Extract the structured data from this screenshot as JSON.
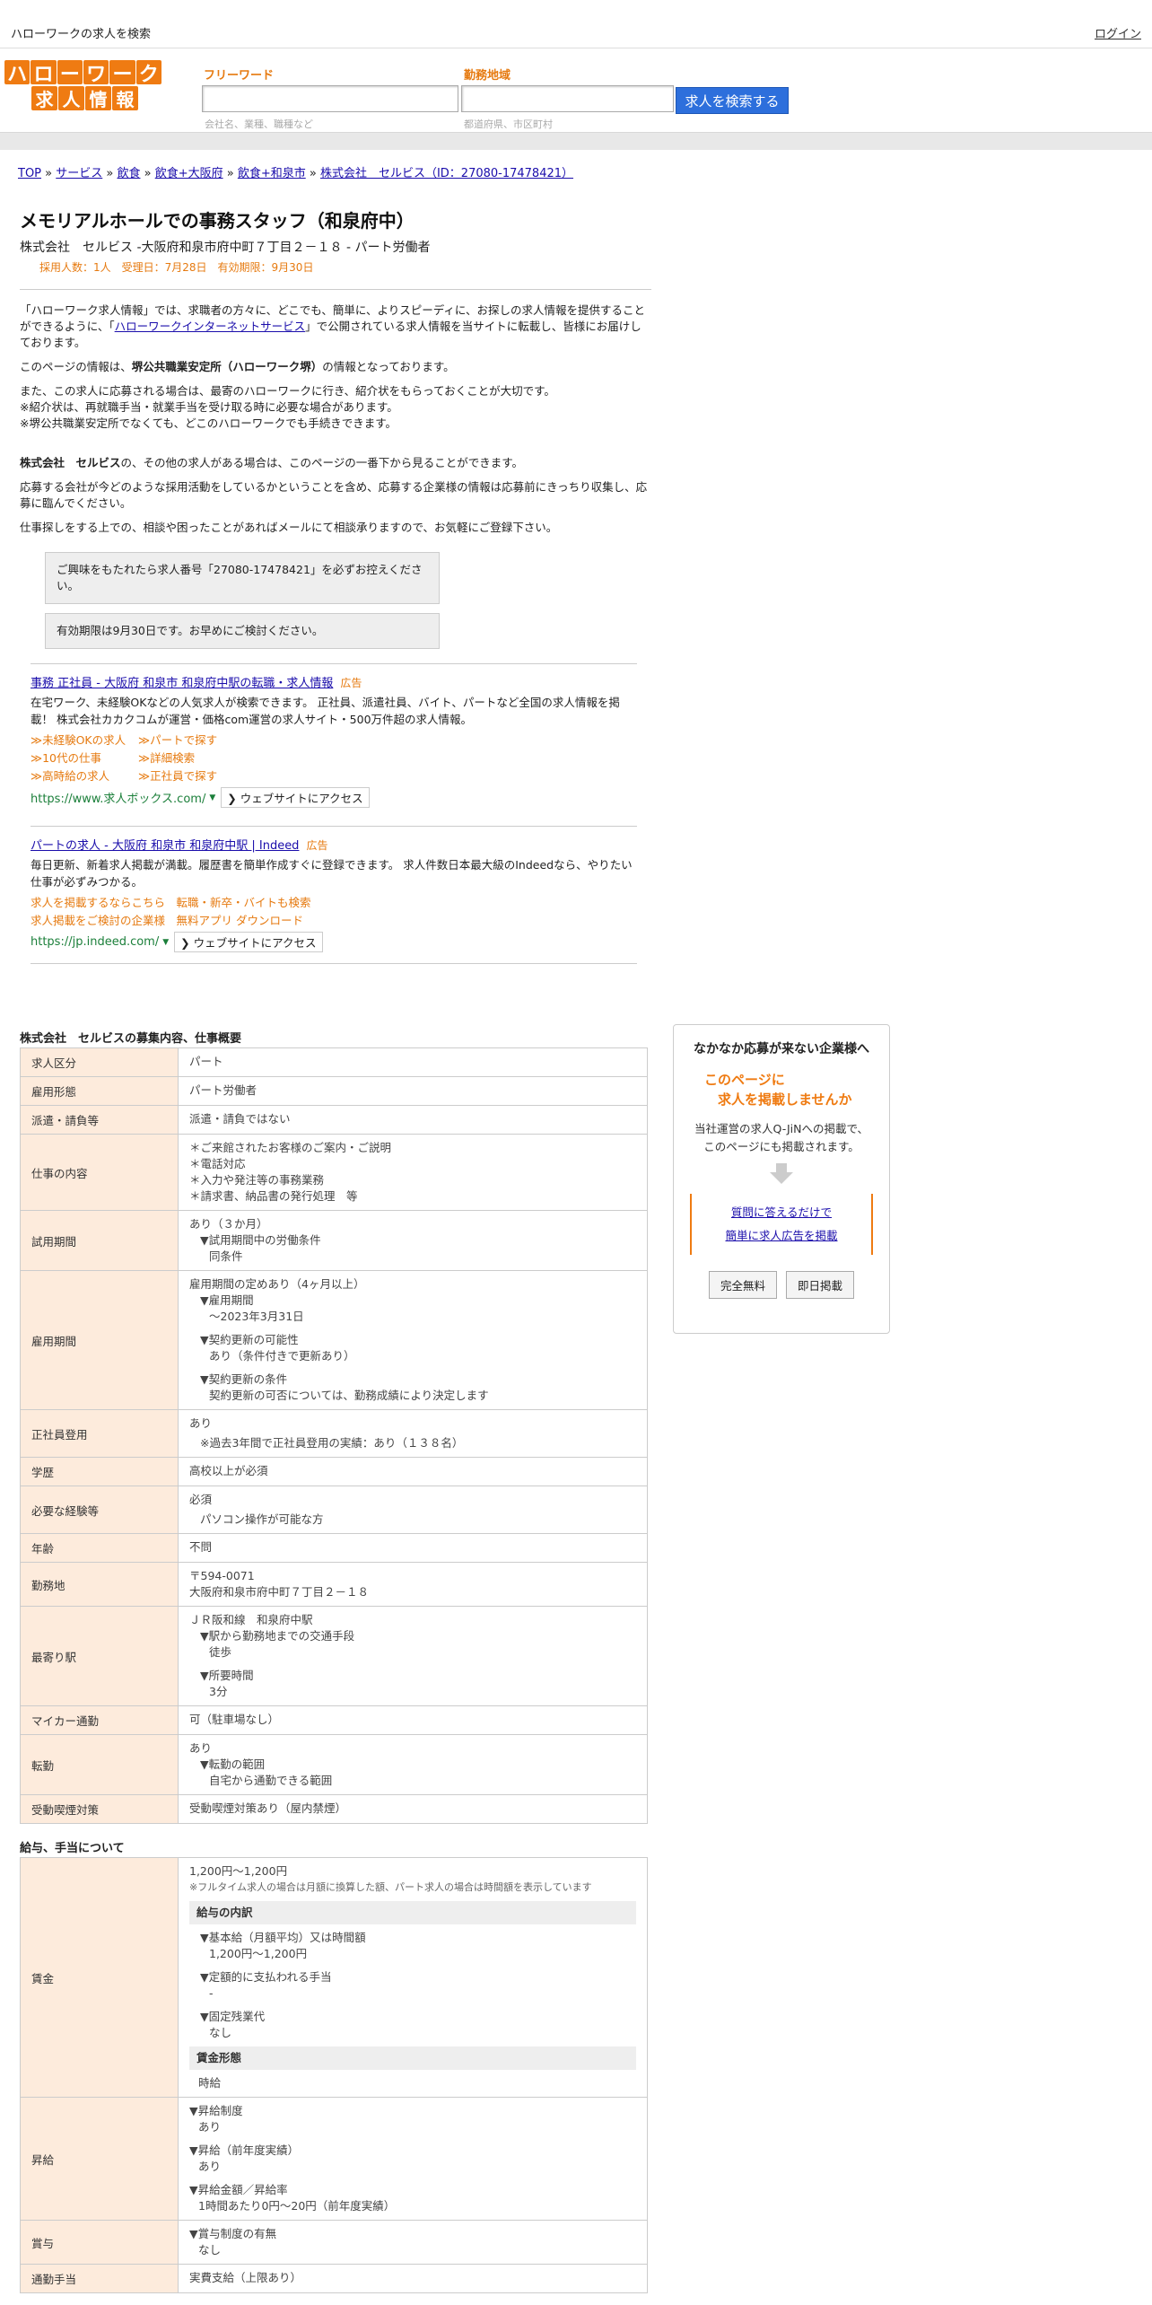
{
  "topbar": {
    "site_title": "ハローワークの求人を検索",
    "login": "ログイン"
  },
  "logo": {
    "row1": [
      "ハ",
      "ロ",
      "ー",
      "ワ",
      "ー",
      "ク"
    ],
    "row2": [
      "求",
      "人",
      "情",
      "報"
    ]
  },
  "search": {
    "freeword_label": "フリーワード",
    "freeword_hint": "会社名、業種、職種など",
    "area_label": "勤務地域",
    "area_hint": "都道府県、市区町村",
    "button": "求人を検索する"
  },
  "breadcrumb": {
    "items": [
      "TOP",
      "サービス",
      "飲食",
      "飲食+大阪府",
      "飲食+和泉市",
      "株式会社　セルビス（ID：27080-17478421）"
    ],
    "sep": " » "
  },
  "job": {
    "title": "メモリアルホールでの事務スタッフ（和泉府中）",
    "company_line": "株式会社　セルビス -大阪府和泉市府中町７丁目２－１８ - パート労働者",
    "meta": "採用人数：1人　受理日：7月28日　有効期限：9月30日"
  },
  "intro": {
    "p1_a": "「ハローワーク求人情報」では、求職者の方々に、どこでも、簡単に、よりスピーディに、お探しの求人情報を提供することができるように、「",
    "p1_link": "ハローワークインターネットサービス",
    "p1_b": "」で公開されている求人情報を当サイトに転載し、皆様にお届けしております。",
    "p2_a": "このページの情報は、",
    "p2_b": "堺公共職業安定所（ハローワーク堺）",
    "p2_c": "の情報となっております。",
    "p3": "また、この求人に応募される場合は、最寄のハローワークに行き、紹介状をもらっておくことが大切です。",
    "p3b": "※紹介状は、再就職手当・就業手当を受け取る時に必要な場合があります。",
    "p3c": "※堺公共職業安定所でなくても、どこのハローワークでも手続きできます。",
    "p4_a": "株式会社　セルビス",
    "p4_b": "の、その他の求人がある場合は、このページの一番下から見ることができます。",
    "p5": "応募する会社が今どのような採用活動をしているかということを含め、応募する企業様の情報は応募前にきっちり収集し、応募に臨んでください。",
    "p6": "仕事探しをする上での、相談や困ったことがあればメールにて相談承りますので、お気軽にご登録下さい。",
    "notice1": "ご興味をもたれたら求人番号「27080-17478421」を必ずお控えください。",
    "notice2": "有効期限は9月30日です。お早めにご検討ください。"
  },
  "ads": [
    {
      "title": "事務 正社員 - 大阪府 和泉市 和泉府中駅の転職・求人情報",
      "tag": "広告",
      "desc": "在宅ワーク、未経験OKなどの人気求人が検索できます。 正社員、派遣社員、バイト、パートなど全国の求人情報を掲載！ 株式会社カカクコムが運営・価格com運営の求人サイト・500万件超の求人情報。",
      "links": [
        "≫未経験OKの求人",
        "≫パートで探す",
        "≫10代の仕事",
        "≫詳細検索",
        "≫高時給の求人",
        "≫正社員で探す"
      ],
      "url": "https://www.求人ボックス.com/",
      "visit": "ウェブサイトにアクセス"
    },
    {
      "title": "パートの求人 - 大阪府 和泉市 和泉府中駅 | Indeed",
      "tag": "広告",
      "desc": "毎日更新、新着求人掲載が満載。履歴書を簡単作成すぐに登録できます。 求人件数日本最大級のIndeedなら、やりたい仕事が必ずみつかる。",
      "links": [
        "求人を掲載するならこちら　転職・新卒・バイトも検索",
        "求人掲載をご検討の企業様　無料アプリ ダウンロード"
      ],
      "url": "https://jp.indeed.com/",
      "visit": "ウェブサイトにアクセス"
    }
  ],
  "overview": {
    "title": "株式会社　セルビスの募集内容、仕事概要",
    "rows": {
      "kubun": {
        "h": "求人区分",
        "v": "パート"
      },
      "keitai": {
        "h": "雇用形態",
        "v": "パート労働者"
      },
      "haken": {
        "h": "派遣・請負等",
        "v": "派遣・請負ではない"
      },
      "shigoto": {
        "h": "仕事の内容",
        "lines": [
          "＊ご来館されたお客様のご案内・ご説明",
          "＊電話対応",
          "＊入力や発注等の事務業務",
          "＊請求書、納品書の発行処理　等"
        ]
      },
      "shiyo": {
        "h": "試用期間",
        "l1": "あり（３か月）",
        "l2": "▼試用期間中の労働条件",
        "l3": "同条件"
      },
      "koyou": {
        "h": "雇用期間",
        "l1": "雇用期間の定めあり（4ヶ月以上）",
        "l2": "▼雇用期間",
        "l3": "〜2023年3月31日",
        "l4": "▼契約更新の可能性",
        "l5": "あり（条件付きで更新あり）",
        "l6": "▼契約更新の条件",
        "l7": "契約更新の可否については、勤務成績により決定します"
      },
      "seisha": {
        "h": "正社員登用",
        "l1": "あり",
        "l2": "※過去3年間で正社員登用の実績：あり（１３８名）"
      },
      "gakureki": {
        "h": "学歴",
        "v": "高校以上が必須"
      },
      "keiken": {
        "h": "必要な経験等",
        "l1": "必須",
        "l2": "パソコン操作が可能な方"
      },
      "nenrei": {
        "h": "年齢",
        "v": "不問"
      },
      "kinmuchi": {
        "h": "勤務地",
        "l1": "〒594-0071",
        "l2": "大阪府和泉市府中町７丁目２－１８"
      },
      "eki": {
        "h": "最寄り駅",
        "l1": "ＪＲ阪和線　和泉府中駅",
        "l2": "▼駅から勤務地までの交通手段",
        "l3": "徒歩",
        "l4": "▼所要時間",
        "l5": "3分"
      },
      "mycar": {
        "h": "マイカー通勤",
        "v": "可（駐車場なし）"
      },
      "tenkin": {
        "h": "転勤",
        "l1": "あり",
        "l2": "▼転勤の範囲",
        "l3": "自宅から通勤できる範囲"
      },
      "judou": {
        "h": "受動喫煙対策",
        "v": "受動喫煙対策あり（屋内禁煙）"
      }
    }
  },
  "salary": {
    "title": "給与、手当について",
    "chingin": {
      "h": "賃金",
      "range": "1,200円〜1,200円",
      "note": "※フルタイム求人の場合は月額に換算した額、パート求人の場合は時間額を表示しています",
      "sub1": "給与の内訳",
      "k1": "▼基本給（月額平均）又は時間額",
      "k1v": "1,200円〜1,200円",
      "k2": "▼定額的に支払われる手当",
      "k2v": "-",
      "k3": "▼固定残業代",
      "k3v": "なし",
      "sub2": "賃金形態",
      "keitai": "時給"
    },
    "shokyu": {
      "h": "昇給",
      "l1": "▼昇給制度",
      "l2": "あり",
      "l3": "▼昇給（前年度実績）",
      "l4": "あり",
      "l5": "▼昇給金額／昇給率",
      "l6": "1時間あたり0円〜20円（前年度実績）"
    },
    "shoyo": {
      "h": "賞与",
      "l1": "▼賞与制度の有無",
      "l2": "なし"
    },
    "tsukin": {
      "h": "通勤手当",
      "l1": "実費支給（上限あり）"
    }
  },
  "side": {
    "title": "なかなか応募が来ない企業様へ",
    "orange1": "このページに",
    "orange2": "　求人を掲載しませんか",
    "desc1": "当社運営の求人Q-JiNへの掲載で、",
    "desc2": "このページにも掲載されます。",
    "link1": "質問に答えるだけで",
    "link2": "簡単に求人広告を掲載",
    "btn1": "完全無料",
    "btn2": "即日掲載"
  }
}
